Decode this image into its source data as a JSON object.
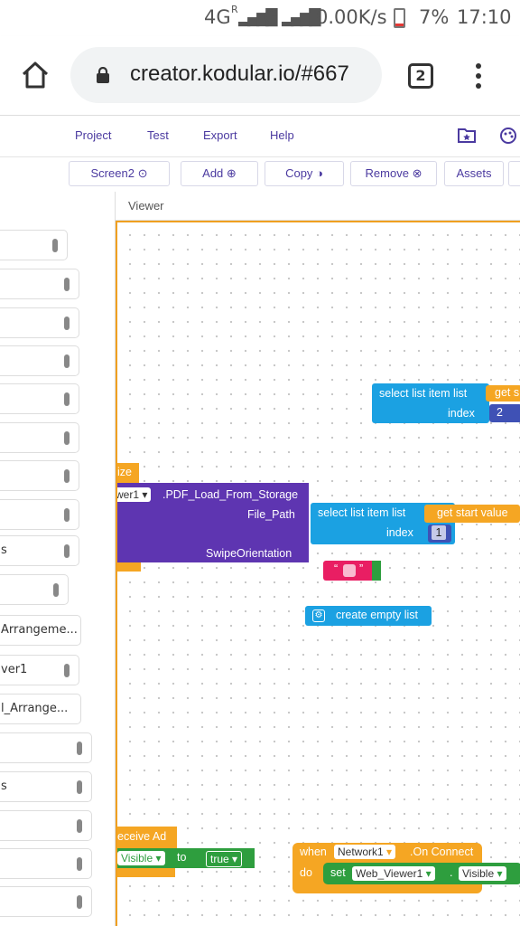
{
  "status": {
    "network": "4G",
    "network_sup": "R",
    "network2": "G",
    "speed": "0.00K/s",
    "battery": "7%",
    "time": "17:10"
  },
  "browser": {
    "url": "creator.kodular.io/#667",
    "tab_count": "2"
  },
  "menu": {
    "project": "Project",
    "test": "Test",
    "export": "Export",
    "help": "Help"
  },
  "toolbar": {
    "screen": "Screen2",
    "add": "Add",
    "copy": "Copy",
    "remove": "Remove",
    "assets": "Assets"
  },
  "sidebar": {
    "items": [
      "",
      "",
      "",
      "",
      "",
      "",
      "",
      "",
      "s",
      "",
      "Arrangeme...",
      "ver1",
      "l_Arrange...",
      "",
      "s",
      "",
      "",
      ""
    ]
  },
  "viewer": {
    "title": "Viewer"
  },
  "blocks": {
    "sel1_label": "select list item  list",
    "sel1_get": "get s",
    "sel1_index": "index",
    "sel1_value": "2",
    "size": "ize",
    "pdf_comp": "wer1",
    "pdf_method": ".PDF_Load_From_Storage",
    "pdf_file": "File_Path",
    "pdf_swipe": "SwipeOrientation",
    "sel2_label": "select list item  list",
    "sel2_get": "get start value",
    "sel2_index": "index",
    "sel2_value": "1",
    "text_open": "“",
    "text_close": "”",
    "empty_list": "create empty list",
    "receive": "eceive Ad",
    "visible": "Visible",
    "to": "to",
    "true": "true",
    "when": "when",
    "network": "Network1",
    "on_connect": ".On Connect",
    "do": "do",
    "set": "set",
    "web": "Web_Viewer1",
    "dot": ".",
    "visible2": "Visible"
  }
}
